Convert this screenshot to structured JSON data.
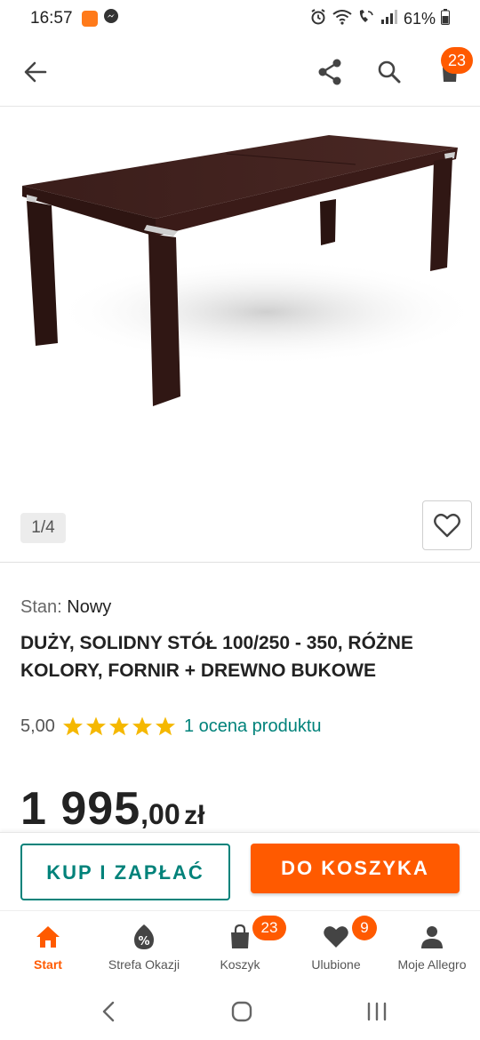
{
  "status_bar": {
    "time": "16:57",
    "battery": "61%"
  },
  "app_bar": {
    "cart_count": "23",
    "icons": [
      "back-arrow-icon",
      "share-icon",
      "search-icon",
      "cart-icon"
    ]
  },
  "gallery": {
    "counter": "1/4"
  },
  "product": {
    "condition_label": "Stan:",
    "condition_value": "Nowy",
    "title": "DUŻY, SOLIDNY STÓŁ 100/250 - 350, RÓŻNE KOLORY, FORNIR + DREWNO BUKOWE",
    "rating_score": "5,00",
    "rating_stars": 5,
    "rating_link": "1 ocena produktu",
    "price_main": "1 995",
    "price_decimal": ",00",
    "price_currency": "zł"
  },
  "actions": {
    "buy_now": "KUP I ZAPŁAĆ",
    "add_to_cart": "DO KOSZYKA"
  },
  "bottom_nav": {
    "items": [
      {
        "label": "Start",
        "icon": "home-icon"
      },
      {
        "label": "Strefa Okazji",
        "icon": "deals-icon"
      },
      {
        "label": "Koszyk",
        "icon": "bag-icon",
        "badge": "23"
      },
      {
        "label": "Ulubione",
        "icon": "heart-icon",
        "badge": "9"
      },
      {
        "label": "Moje Allegro",
        "icon": "user-icon"
      }
    ]
  },
  "colors": {
    "accent": "#ff5a00",
    "teal": "#00827a",
    "star": "#f5b800"
  }
}
